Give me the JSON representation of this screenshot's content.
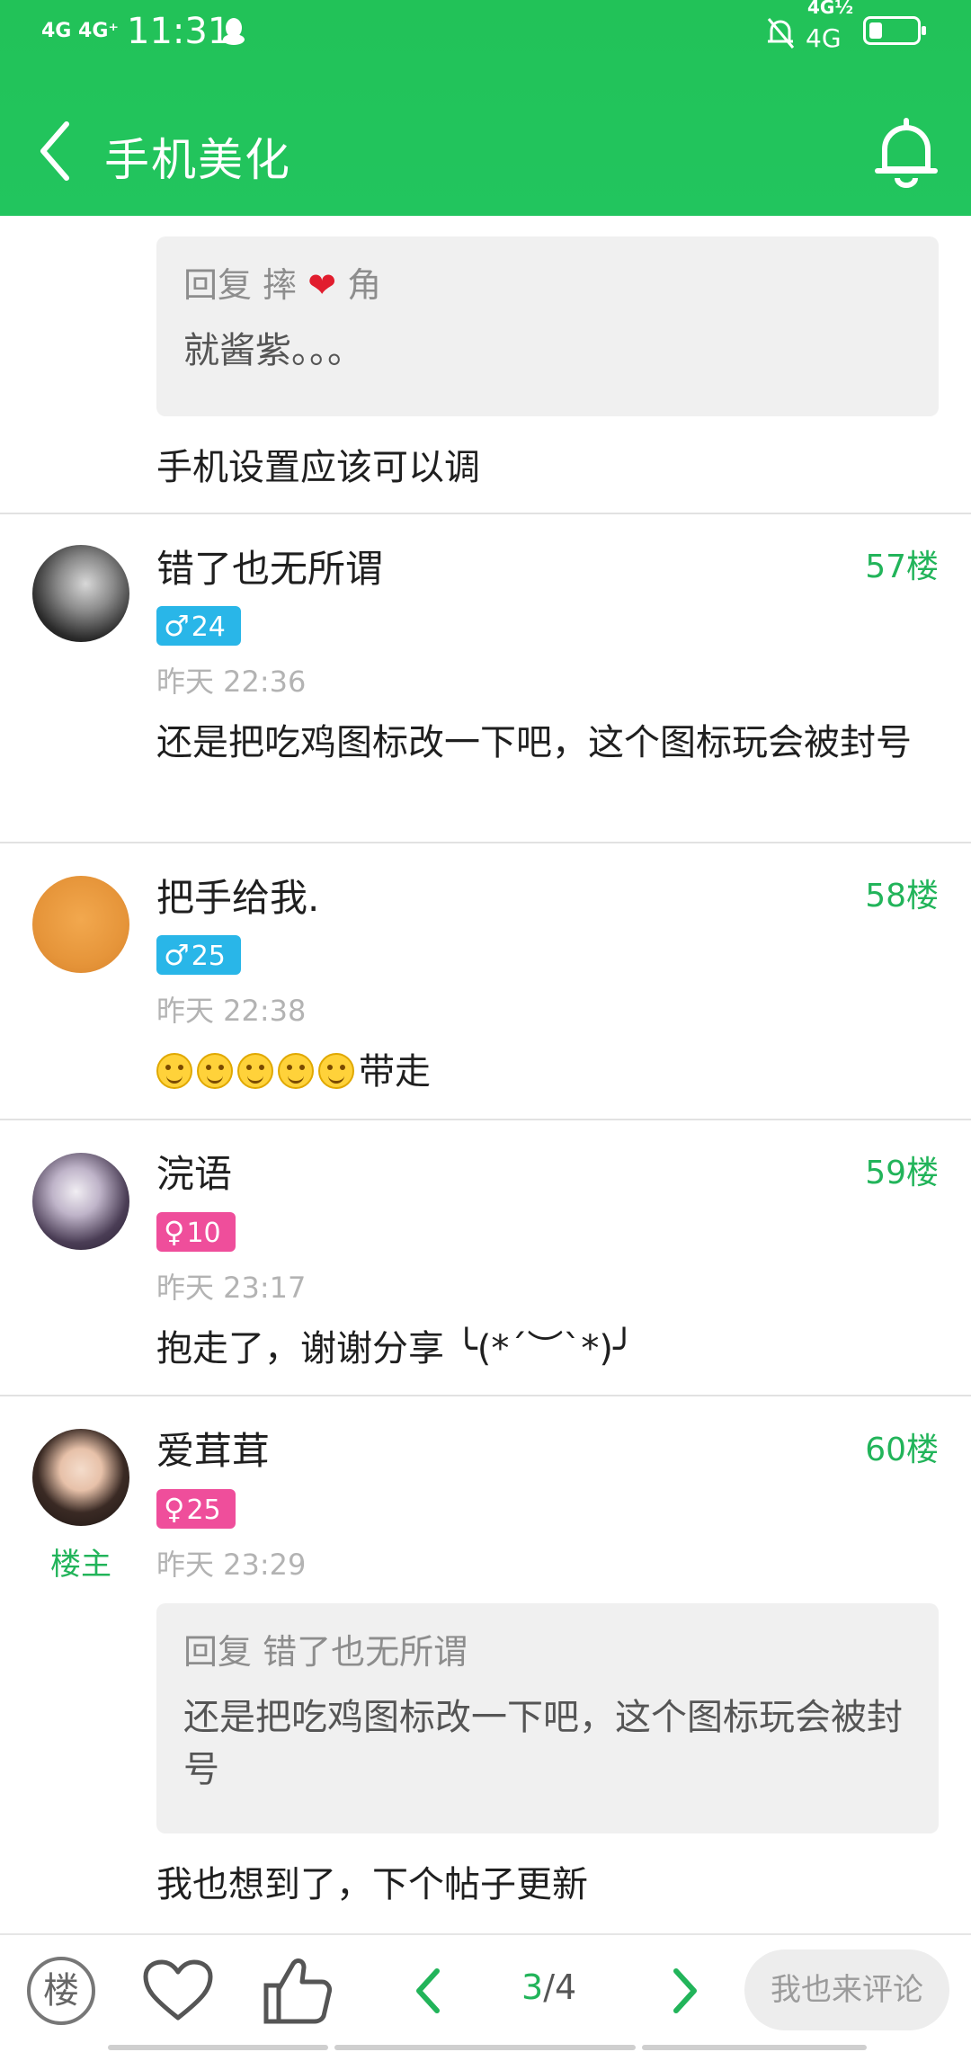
{
  "status_bar": {
    "network": "4G 4G⁺",
    "time": "11:31",
    "network2": "4G½",
    "network3": "4G"
  },
  "header": {
    "title": "手机美化"
  },
  "posts": [
    {
      "quote_prefix": "回复 摔",
      "quote_suffix": "角",
      "quote_text": "就酱紫。。。",
      "text": "手机设置应该可以调"
    },
    {
      "name": "错了也无所谓",
      "gender_symbol": "♂",
      "level": "24",
      "time": "昨天 22:36",
      "floor": "57楼",
      "text": "还是把吃鸡图标改一下吧，这个图标玩会被封号"
    },
    {
      "name": "把手给我.",
      "gender_symbol": "♂",
      "level": "25",
      "time": "昨天 22:38",
      "floor": "58楼",
      "text_after_emoji": "带走"
    },
    {
      "name": "浣语",
      "gender_symbol": "♀",
      "level": "10",
      "time": "昨天 23:17",
      "floor": "59楼",
      "text": "抱走了，谢谢分享 ╰(*´︶`*)╯"
    },
    {
      "name": "爱茸茸",
      "gender_symbol": "♀",
      "level": "25",
      "time": "昨天 23:29",
      "floor": "60楼",
      "owner_label": "楼主",
      "quote_prefix": "回复 错了也无所谓",
      "quote_text": "还是把吃鸡图标改一下吧，这个图标玩会被封号",
      "text": "我也想到了，下个帖子更新"
    }
  ],
  "bottom_bar": {
    "floor_label": "楼",
    "page_current": "3",
    "page_total": "/4",
    "comment_label": "我也来评论"
  },
  "colors": {
    "accent": "#22c55e",
    "floor": "#22b45a",
    "male": "#29b6e8",
    "female": "#ef4e9b"
  }
}
